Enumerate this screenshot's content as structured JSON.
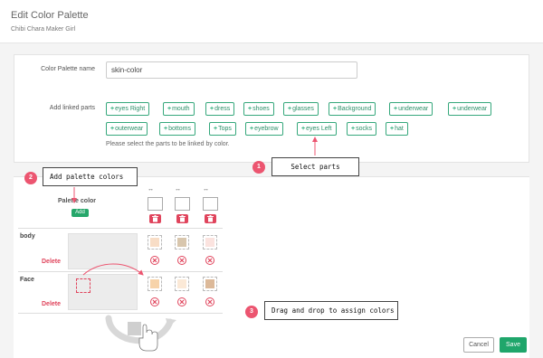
{
  "header": {
    "title": "Edit Color Palette",
    "subtitle": "Chibi Chara Maker Girl"
  },
  "form": {
    "name_label": "Color Palette name",
    "name_value": "skin-color",
    "parts_label": "Add linked parts",
    "parts": [
      "eyes Right",
      "mouth",
      "dress",
      "shoes",
      "glasses",
      "Background",
      "underwear",
      "underwear",
      "outerwear",
      "bottoms",
      "Tops",
      "eyebrow",
      "eyes Left",
      "socks",
      "hat"
    ],
    "help_text": "Please select the parts to be linked by color.",
    "plus_glyph": "+"
  },
  "palette": {
    "header_label": "Palette color",
    "add_label": "Add",
    "column_arrows": "↔",
    "rows": [
      {
        "name": "body",
        "delete_label": "Delete",
        "swatches": [
          "#f8ddc6",
          "#d8c6ad",
          "#fbe3df"
        ]
      },
      {
        "name": "Face",
        "delete_label": "Delete",
        "swatches": [
          "#f7d3a9",
          "#fbe9d7",
          "#dcb999"
        ]
      }
    ]
  },
  "callouts": [
    {
      "number": "1",
      "text": "Select parts"
    },
    {
      "number": "2",
      "text": "Add palette colors"
    },
    {
      "number": "3",
      "text": "Drag and drop to assign colors"
    }
  ],
  "footer": {
    "cancel_label": "Cancel",
    "save_label": "Save"
  },
  "colors": {
    "accent_green": "#26a76b",
    "delete_red": "#e0445c",
    "callout_pink": "#ec5570"
  }
}
